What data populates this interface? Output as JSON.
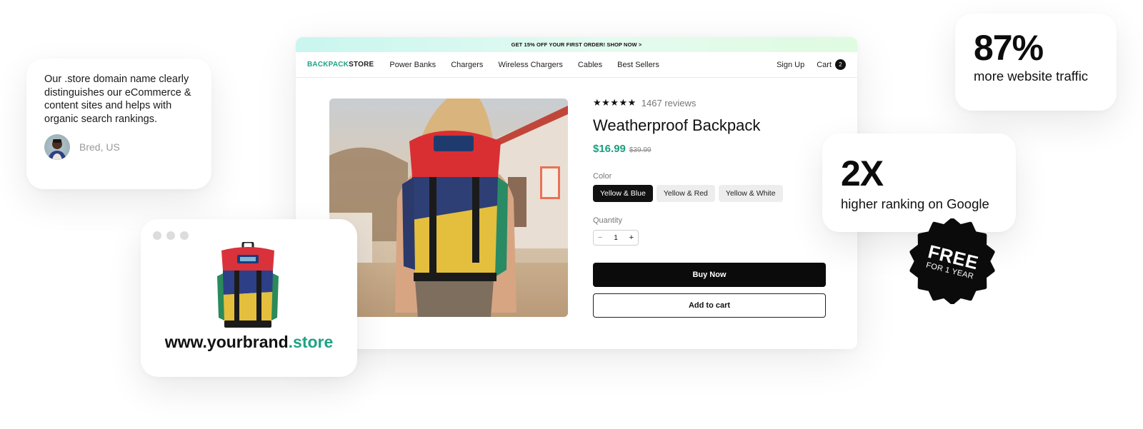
{
  "store": {
    "promo_banner": "GET 15% OFF YOUR FIRST ORDER! SHOP NOW >",
    "logo": {
      "part1": "BACKPACK",
      "part2": "STORE"
    },
    "nav_links": [
      "Power Banks",
      "Chargers",
      "Wireless Chargers",
      "Cables",
      "Best Sellers"
    ],
    "sign_up": "Sign Up",
    "cart": {
      "label": "Cart",
      "count": "2"
    },
    "product": {
      "rating_stars": "★★★★★",
      "reviews": "1467 reviews",
      "title": "Weatherproof Backpack",
      "price": "$16.99",
      "old_price": "$39.99",
      "color_label": "Color",
      "colors": [
        "Yellow & Blue",
        "Yellow & Red",
        "Yellow & White"
      ],
      "selected_color": "Yellow & Blue",
      "quantity_label": "Quantity",
      "quantity": "1",
      "minus": "−",
      "plus": "+",
      "buy_now": "Buy Now",
      "add_to_cart": "Add to cart"
    }
  },
  "testimonial": {
    "quote": "Our .store domain name clearly distinguishes our eCommerce & content sites and helps with organic search rankings.",
    "author": "Bred, US"
  },
  "domain_card": {
    "domain_main": "www.yourbrand",
    "domain_ext": ".store"
  },
  "stats": [
    {
      "value": "87%",
      "text": "more website traffic"
    },
    {
      "value": "2X",
      "text": "higher ranking on Google"
    }
  ],
  "badge": {
    "main": "FREE",
    "sub": "FOR 1 YEAR"
  },
  "colors": {
    "brand_green": "#1fa386",
    "price_green": "#1a9f7f",
    "dark": "#0b0b0b"
  }
}
